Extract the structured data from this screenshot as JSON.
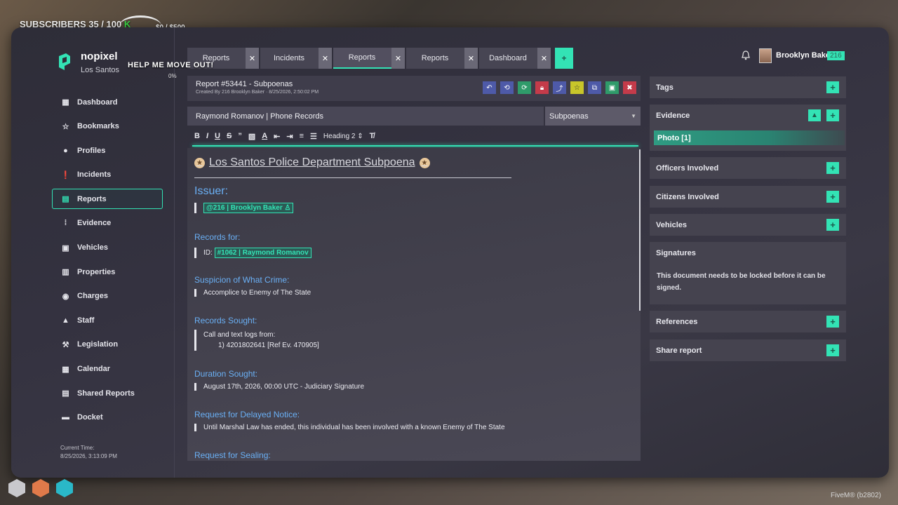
{
  "overlay": {
    "subscribers": "SUBSCRIBERS 35 / 100",
    "money": "$0 / $500",
    "help": "HELP ME MOVE OUT!",
    "percent": "0%"
  },
  "brand": {
    "name": "nopixel",
    "city": "Los Santos"
  },
  "nav": [
    {
      "label": "Dashboard",
      "icon": "dashboard-icon"
    },
    {
      "label": "Bookmarks",
      "icon": "star-icon"
    },
    {
      "label": "Profiles",
      "icon": "person-icon"
    },
    {
      "label": "Incidents",
      "icon": "alert-icon"
    },
    {
      "label": "Reports",
      "icon": "document-icon",
      "active": true
    },
    {
      "label": "Evidence",
      "icon": "footprints-icon"
    },
    {
      "label": "Vehicles",
      "icon": "car-icon"
    },
    {
      "label": "Properties",
      "icon": "building-icon"
    },
    {
      "label": "Charges",
      "icon": "location-pin-icon"
    },
    {
      "label": "Staff",
      "icon": "graduation-cap-icon"
    },
    {
      "label": "Legislation",
      "icon": "gavel-icon"
    },
    {
      "label": "Calendar",
      "icon": "calendar-icon"
    },
    {
      "label": "Shared Reports",
      "icon": "file-icon"
    },
    {
      "label": "Docket",
      "icon": "archive-icon"
    }
  ],
  "time": {
    "label": "Current Time:",
    "value": "8/25/2026, 3:13:09 PM"
  },
  "tabs": [
    {
      "label": "Reports"
    },
    {
      "label": "Incidents"
    },
    {
      "label": "Reports",
      "active": true
    },
    {
      "label": "Reports"
    },
    {
      "label": "Dashboard"
    }
  ],
  "user": {
    "name": "Brooklyn Baker",
    "badge": "216"
  },
  "report": {
    "title": "Report #53441 - Subpoenas",
    "created": "Created By 216 Brooklyn Baker · 8/25/2026, 2:50:02 PM",
    "subject": "Raymond Romanov | Phone Records",
    "category": "Subpoenas"
  },
  "toolbar": {
    "bold": "B",
    "italic": "I",
    "underline": "U",
    "strike": "S",
    "quote": "”",
    "heading": "Heading 2",
    "clear": "T̸"
  },
  "doc": {
    "title": "Los Santos Police Department Subpoena",
    "issuer_h": "Issuer:",
    "issuer": "@216 | Brooklyn Baker",
    "records_for_h": "Records for:",
    "id_label": "ID:",
    "records_for": "#1062 | Raymond Romanov",
    "crime_h": "Suspicion of What Crime:",
    "crime": "Accomplice to Enemy of The State",
    "sought_h": "Records Sought:",
    "sought_1": "Call and text logs from:",
    "sought_2": "1) 4201802641 [Ref Ev. 470905]",
    "duration_h": "Duration Sought:",
    "duration": "August 17th, 2026, 00:00 UTC - Judiciary Signature",
    "delayed_h": "Request for Delayed Notice:",
    "delayed": "Until Marshal Law has ended, this individual has been involved with a known Enemy of The State",
    "sealing_h": "Request for Sealing:"
  },
  "panels": {
    "tags": "Tags",
    "evidence": "Evidence",
    "photo": "Photo [1]",
    "officers": "Officers Involved",
    "citizens": "Citizens Involved",
    "vehicles": "Vehicles",
    "signatures": "Signatures",
    "sig_text": "This document needs to be locked before it can be signed.",
    "references": "References",
    "share": "Share report"
  },
  "footer": {
    "build": "FiveM® (b2802)"
  },
  "colors": {
    "accent": "#33e3b5",
    "heading_blue": "#6ab0f5",
    "panel": "#45434f"
  }
}
